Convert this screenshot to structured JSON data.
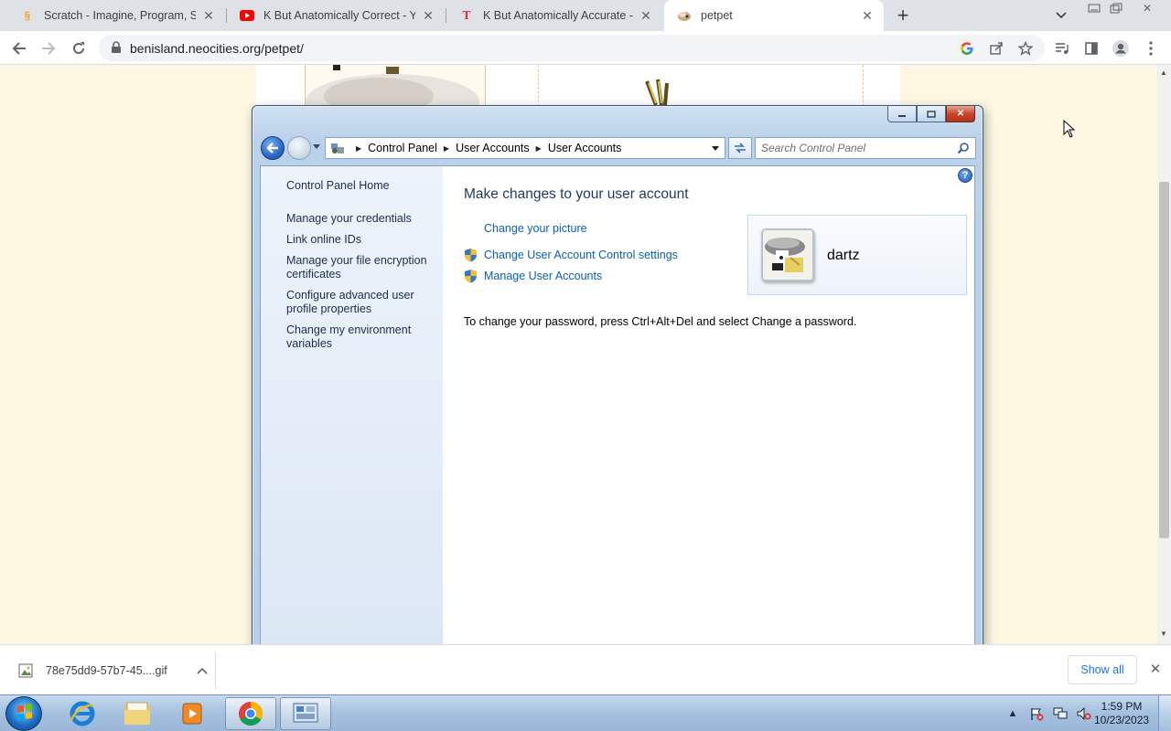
{
  "browser": {
    "tabs": [
      {
        "title": "Scratch - Imagine, Program, Share",
        "favicon": "scratch-icon",
        "active": false
      },
      {
        "title": "K But Anatomically Correct - YouTube",
        "favicon": "youtube-icon",
        "active": false
      },
      {
        "title": "K But Anatomically Accurate - Tumblr",
        "favicon": "tumblr-icon",
        "active": false
      },
      {
        "title": "petpet",
        "favicon": "petpet-icon",
        "active": true
      }
    ],
    "url": "benisland.neocities.org/petpet/"
  },
  "control_panel": {
    "breadcrumb": [
      "Control Panel",
      "User Accounts",
      "User Accounts"
    ],
    "search_placeholder": "Search Control Panel",
    "sidebar": {
      "home": "Control Panel Home",
      "links": [
        "Manage your credentials",
        "Link online IDs",
        "Manage your file encryption certificates",
        "Configure advanced user profile properties",
        "Change my environment variables"
      ]
    },
    "heading": "Make changes to your user account",
    "actions": [
      {
        "label": "Change your picture",
        "shield": false
      },
      {
        "label": "Change User Account Control settings",
        "shield": true
      },
      {
        "label": "Manage User Accounts",
        "shield": true
      }
    ],
    "note": "To change your password, press Ctrl+Alt+Del and select Change a password.",
    "user": {
      "name": "dartz"
    }
  },
  "downloads": {
    "file_name": "78e75dd9-57b7-45....gif",
    "show_all": "Show all"
  },
  "taskbar": {
    "time": "1:59 PM",
    "date": "10/23/2023"
  },
  "colors": {
    "page_background": "#fef8e3",
    "link_blue": "#0a5fb6",
    "heading_blue": "#1e395b",
    "chrome_tabstrip": "#dee1e6"
  }
}
